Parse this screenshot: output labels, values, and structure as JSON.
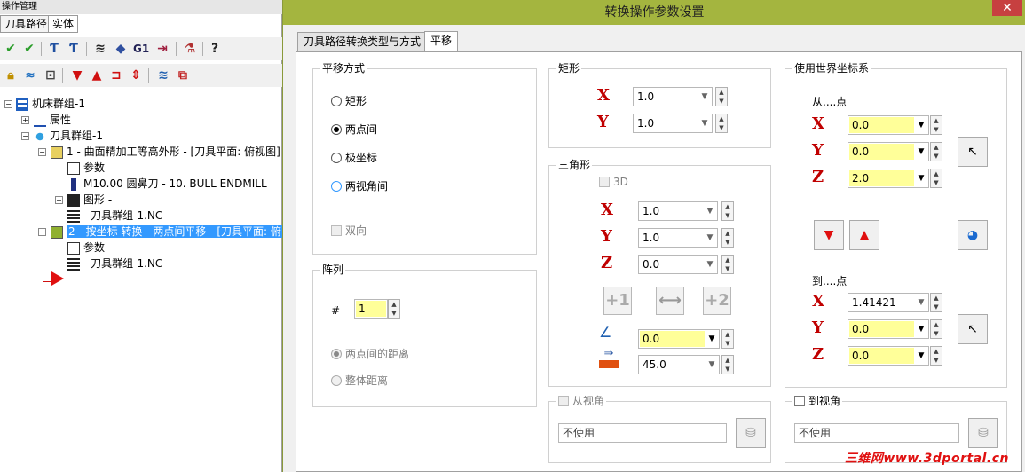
{
  "left": {
    "title": "操作管理",
    "tabs": [
      "刀具路径",
      "实体"
    ],
    "tree": {
      "machine_group": "机床群组-1",
      "properties": "属性",
      "toolpath_group": "刀具群组-1",
      "op1": "1 - 曲面精加工等高外形 - [刀具平面: 俯视图]",
      "op1_params": "参数",
      "op1_tool": "M10.00 圆鼻刀 -    10. BULL ENDMILL",
      "op1_geometry": "图形 -",
      "op1_nc": "- 刀具群组-1.NC",
      "op2": "2 - 按坐标 转换 - 两点间平移 - [刀具平面: 俯",
      "op2_params": "参数",
      "op2_nc": "- 刀具群组-1.NC"
    }
  },
  "dialog": {
    "title": "转换操作参数设置",
    "tabs": [
      "刀具路径转换类型与方式",
      "平移"
    ],
    "translate_method": {
      "label": "平移方式",
      "options": [
        "矩形",
        "两点间",
        "极坐标",
        "两视角间"
      ],
      "selected": "两点间",
      "bidirectional": "双向"
    },
    "array": {
      "label": "阵列",
      "count_label": "#",
      "count": "1",
      "distance_options": [
        "两点间的距离",
        "整体距离"
      ]
    },
    "rectangle": {
      "label": "矩形",
      "x": "1.0",
      "y": "1.0"
    },
    "triangle": {
      "label": "三角形",
      "threed": "3D",
      "x": "1.0",
      "y": "1.0",
      "z": "0.0",
      "angle": "0.0",
      "distance": "45.0",
      "btn1": "+1",
      "btn2": "+2"
    },
    "from_view": {
      "label": "从视角",
      "value": "不使用"
    },
    "world": {
      "label": "使用世界坐标系",
      "from_label": "从....点",
      "from_x": "0.0",
      "from_y": "0.0",
      "from_z": "2.0",
      "to_label": "到....点",
      "to_x": "1.41421",
      "to_y": "0.0",
      "to_z": "0.0"
    },
    "to_view": {
      "label": "到视角",
      "value": "不使用"
    },
    "axis_labels": {
      "x": "X",
      "y": "Y",
      "z": "Z"
    }
  },
  "watermark": "三维网www.3dportal.cn"
}
